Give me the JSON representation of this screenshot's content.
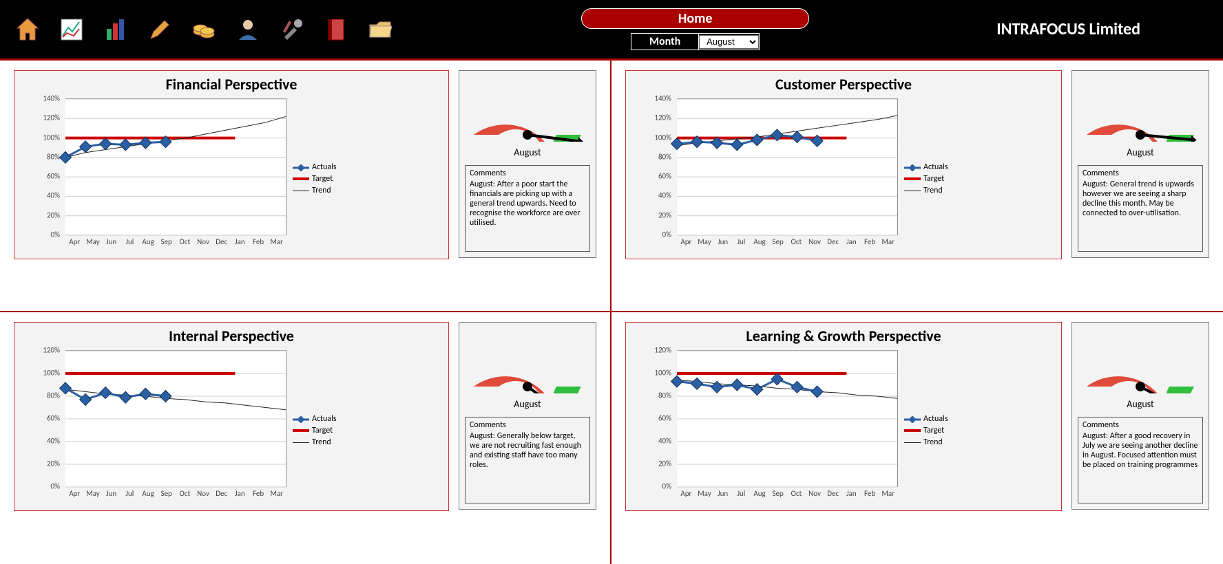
{
  "header": {
    "home_label": "Home",
    "month_label": "Month",
    "selected_month": "August",
    "company": "INTRAFOCUS Limited"
  },
  "months": [
    "Apr",
    "May",
    "Jun",
    "Jul",
    "Aug",
    "Sep",
    "Oct",
    "Nov",
    "Dec",
    "Jan",
    "Feb",
    "Mar"
  ],
  "legend": {
    "actuals": "Actuals",
    "target": "Target",
    "trend": "Trend"
  },
  "comments_header": "Comments",
  "panels": [
    {
      "title": "Financial Perspective",
      "gauge_month": "August",
      "gauge_value": 96,
      "y_ticks": [
        0,
        20,
        40,
        60,
        80,
        100,
        120,
        140
      ],
      "ymin": 0,
      "ymax": 140,
      "target": 100,
      "trend": [
        80,
        85,
        88,
        91,
        94,
        97,
        100,
        104,
        108,
        112,
        116,
        122
      ],
      "actuals": [
        80,
        91,
        94,
        93,
        95,
        96
      ],
      "comment": "August: After a poor start the financials are picking up with a general trend upwards.  Need to recognise the workforce are over utilised."
    },
    {
      "title": "Customer Perspective",
      "gauge_month": "August",
      "gauge_value": 97,
      "y_ticks": [
        0,
        20,
        40,
        60,
        80,
        100,
        120,
        140
      ],
      "ymin": 0,
      "ymax": 140,
      "target": 100,
      "trend": [
        92,
        95,
        97,
        99,
        101,
        104,
        107,
        110,
        113,
        116,
        119,
        123
      ],
      "actuals": [
        94,
        96,
        95,
        93,
        98,
        103,
        101,
        97
      ],
      "comment": "August: General trend is upwards however we are seeing a sharp decline this month.  May be connected to over-utilisation."
    },
    {
      "title": "Internal Perspective",
      "gauge_month": "August",
      "gauge_value": 80,
      "y_ticks": [
        0,
        20,
        40,
        60,
        80,
        100,
        120
      ],
      "ymin": 0,
      "ymax": 120,
      "target": 100,
      "trend": [
        86,
        84,
        82,
        81,
        80,
        78,
        77,
        75,
        74,
        72,
        70,
        68
      ],
      "actuals": [
        87,
        77,
        83,
        79,
        82,
        80
      ],
      "comment": "August: Generally below target, we are not recruiting fast enough and existing staff have too many roles."
    },
    {
      "title": "Learning & Growth Perspective",
      "gauge_month": "August",
      "gauge_value": 84,
      "y_ticks": [
        0,
        20,
        40,
        60,
        80,
        100,
        120
      ],
      "ymin": 0,
      "ymax": 120,
      "target": 100,
      "trend": [
        94,
        93,
        91,
        90,
        89,
        87,
        86,
        84,
        83,
        81,
        80,
        78
      ],
      "actuals": [
        93,
        91,
        88,
        90,
        86,
        95,
        88,
        84
      ],
      "comment": "August: After a good recovery in July we are seeing another decline in August.  Focused attention must be placed on training programmes"
    }
  ],
  "chart_data": [
    {
      "type": "line",
      "title": "Financial Perspective",
      "categories": [
        "Apr",
        "May",
        "Jun",
        "Jul",
        "Aug",
        "Sep",
        "Oct",
        "Nov",
        "Dec",
        "Jan",
        "Feb",
        "Mar"
      ],
      "series": [
        {
          "name": "Actuals",
          "values": [
            80,
            91,
            94,
            93,
            95,
            96,
            null,
            null,
            null,
            null,
            null,
            null
          ]
        },
        {
          "name": "Target",
          "values": [
            100,
            100,
            100,
            100,
            100,
            100,
            100,
            100,
            100,
            100,
            100,
            100
          ]
        },
        {
          "name": "Trend",
          "values": [
            80,
            85,
            88,
            91,
            94,
            97,
            100,
            104,
            108,
            112,
            116,
            122
          ]
        }
      ],
      "ylim": [
        0,
        140
      ],
      "ylabel": "%",
      "xlabel": ""
    },
    {
      "type": "line",
      "title": "Customer Perspective",
      "categories": [
        "Apr",
        "May",
        "Jun",
        "Jul",
        "Aug",
        "Sep",
        "Oct",
        "Nov",
        "Dec",
        "Jan",
        "Feb",
        "Mar"
      ],
      "series": [
        {
          "name": "Actuals",
          "values": [
            94,
            96,
            95,
            93,
            98,
            103,
            101,
            97,
            null,
            null,
            null,
            null
          ]
        },
        {
          "name": "Target",
          "values": [
            100,
            100,
            100,
            100,
            100,
            100,
            100,
            100,
            100,
            100,
            100,
            100
          ]
        },
        {
          "name": "Trend",
          "values": [
            92,
            95,
            97,
            99,
            101,
            104,
            107,
            110,
            113,
            116,
            119,
            123
          ]
        }
      ],
      "ylim": [
        0,
        140
      ],
      "ylabel": "%",
      "xlabel": ""
    },
    {
      "type": "line",
      "title": "Internal Perspective",
      "categories": [
        "Apr",
        "May",
        "Jun",
        "Jul",
        "Aug",
        "Sep",
        "Oct",
        "Nov",
        "Dec",
        "Jan",
        "Feb",
        "Mar"
      ],
      "series": [
        {
          "name": "Actuals",
          "values": [
            87,
            77,
            83,
            79,
            82,
            80,
            null,
            null,
            null,
            null,
            null,
            null
          ]
        },
        {
          "name": "Target",
          "values": [
            100,
            100,
            100,
            100,
            100,
            100,
            100,
            100,
            100,
            100,
            100,
            100
          ]
        },
        {
          "name": "Trend",
          "values": [
            86,
            84,
            82,
            81,
            80,
            78,
            77,
            75,
            74,
            72,
            70,
            68
          ]
        }
      ],
      "ylim": [
        0,
        120
      ],
      "ylabel": "%",
      "xlabel": ""
    },
    {
      "type": "line",
      "title": "Learning & Growth Perspective",
      "categories": [
        "Apr",
        "May",
        "Jun",
        "Jul",
        "Aug",
        "Sep",
        "Oct",
        "Nov",
        "Dec",
        "Jan",
        "Feb",
        "Mar"
      ],
      "series": [
        {
          "name": "Actuals",
          "values": [
            93,
            91,
            88,
            90,
            86,
            95,
            88,
            84,
            null,
            null,
            null,
            null
          ]
        },
        {
          "name": "Target",
          "values": [
            100,
            100,
            100,
            100,
            100,
            100,
            100,
            100,
            100,
            100,
            100,
            100
          ]
        },
        {
          "name": "Trend",
          "values": [
            94,
            93,
            91,
            90,
            89,
            87,
            86,
            84,
            83,
            81,
            80,
            78
          ]
        }
      ],
      "ylim": [
        0,
        120
      ],
      "ylabel": "%",
      "xlabel": ""
    }
  ]
}
